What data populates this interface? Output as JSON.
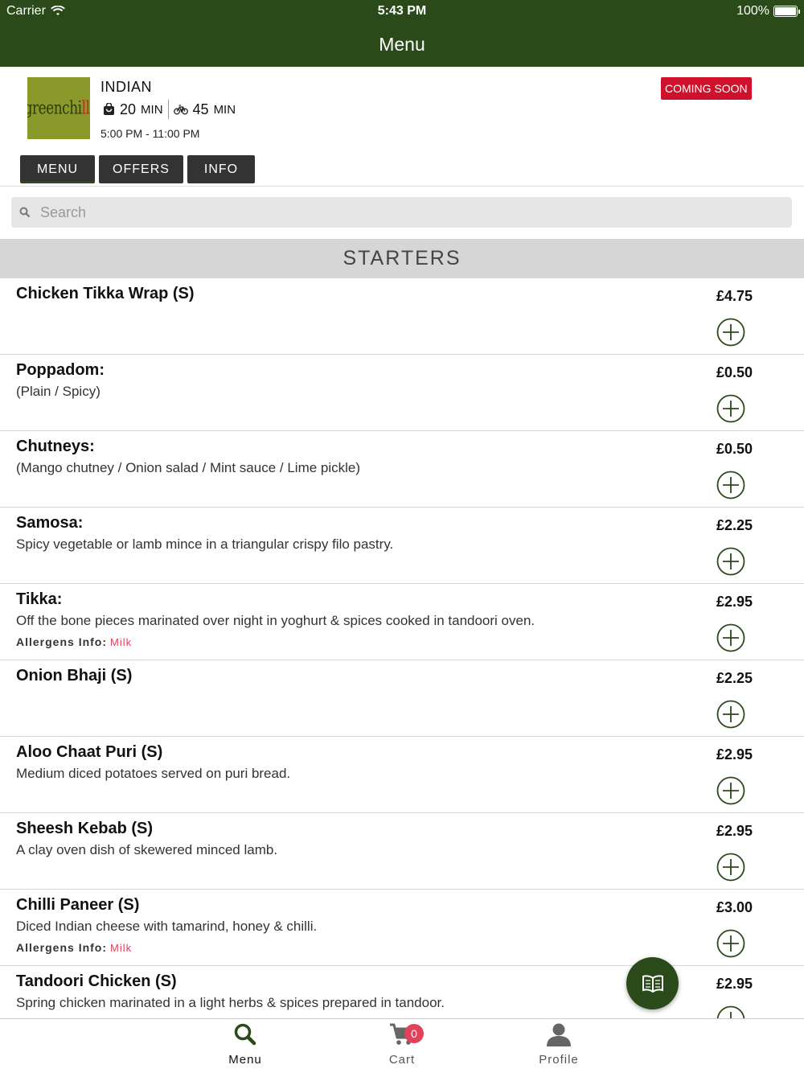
{
  "status_bar": {
    "carrier": "Carrier",
    "time": "5:43 PM",
    "battery": "100%"
  },
  "header": {
    "title": "Menu"
  },
  "restaurant": {
    "logo_text_a": "greenchi",
    "logo_text_b": "lli",
    "cuisine": "INDIAN",
    "collection_time": "20",
    "delivery_time": "45",
    "time_unit": "MIN",
    "hours": "5:00 PM - 11:00 PM",
    "status_badge": "COMING SOON"
  },
  "tabs": [
    {
      "label": "MENU"
    },
    {
      "label": "OFFERS"
    },
    {
      "label": "INFO"
    }
  ],
  "search": {
    "placeholder": "Search"
  },
  "category": {
    "title": "STARTERS"
  },
  "allergen_label": "Allergens Info:",
  "items": [
    {
      "name": "Chicken Tikka Wrap (S)",
      "desc": "",
      "allergens": "",
      "price": "£4.75"
    },
    {
      "name": "Poppadom:",
      "desc": "(Plain / Spicy)",
      "allergens": "",
      "price": "£0.50"
    },
    {
      "name": "Chutneys:",
      "desc": "(Mango chutney / Onion salad / Mint sauce / Lime pickle)",
      "allergens": "",
      "price": "£0.50"
    },
    {
      "name": "Samosa:",
      "desc": "Spicy vegetable or lamb mince in a triangular crispy filo pastry.",
      "allergens": "",
      "price": "£2.25"
    },
    {
      "name": "Tikka:",
      "desc": "Off the bone pieces marinated over night in yoghurt & spices cooked in tandoori oven.",
      "allergens": "Milk",
      "price": "£2.95"
    },
    {
      "name": "Onion Bhaji (S)",
      "desc": "",
      "allergens": "",
      "price": "£2.25"
    },
    {
      "name": "Aloo Chaat Puri (S)",
      "desc": "Medium diced potatoes served on puri bread.",
      "allergens": "",
      "price": "£2.95"
    },
    {
      "name": "Sheesh Kebab (S)",
      "desc": "A clay oven dish of skewered minced lamb.",
      "allergens": "",
      "price": "£2.95"
    },
    {
      "name": "Chilli Paneer (S)",
      "desc": "Diced Indian cheese with tamarind, honey & chilli.",
      "allergens": "Milk",
      "price": "£3.00"
    },
    {
      "name": "Tandoori Chicken (S)",
      "desc": "Spring chicken marinated in a light herbs & spices prepared in tandoor.",
      "allergens": "",
      "price": "£2.95"
    }
  ],
  "tabbar": {
    "menu": "Menu",
    "cart": "Cart",
    "cart_count": "0",
    "profile": "Profile"
  },
  "colors": {
    "brand": "#2a4a1a",
    "badge": "#d0112b",
    "allergen": "#e0425a"
  }
}
